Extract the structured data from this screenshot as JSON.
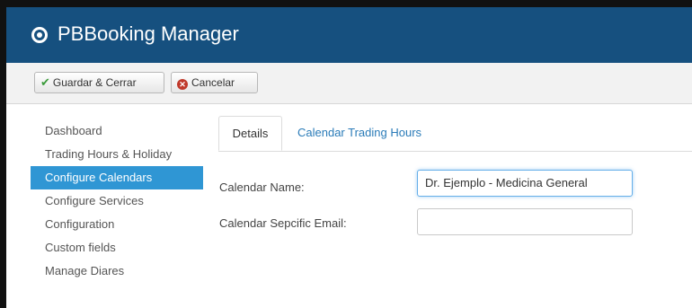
{
  "header": {
    "title": "PBBooking Manager",
    "logo_icon": "circle-dot-icon"
  },
  "toolbar": {
    "save_label": "Guardar & Cerrar",
    "cancel_label": "Cancelar"
  },
  "sidebar": {
    "items": [
      {
        "label": "Dashboard",
        "active": false
      },
      {
        "label": "Trading Hours & Holiday",
        "active": false
      },
      {
        "label": "Configure Calendars",
        "active": true
      },
      {
        "label": "Configure Services",
        "active": false
      },
      {
        "label": "Configuration",
        "active": false
      },
      {
        "label": "Custom fields",
        "active": false
      },
      {
        "label": "Manage Diares",
        "active": false
      }
    ]
  },
  "tabs": [
    {
      "label": "Details",
      "active": true
    },
    {
      "label": "Calendar Trading Hours",
      "active": false
    }
  ],
  "form": {
    "calendar_name_label": "Calendar Name:",
    "calendar_name_value": "Dr. Ejemplo - Medicina General",
    "calendar_email_label": "Calendar Sepcific Email:",
    "calendar_email_value": ""
  },
  "colors": {
    "header_bg": "#16507f",
    "active_item": "#2f96d4",
    "link": "#2a7bb8",
    "save_icon": "#3b9b3b",
    "cancel_icon": "#c0392b"
  }
}
